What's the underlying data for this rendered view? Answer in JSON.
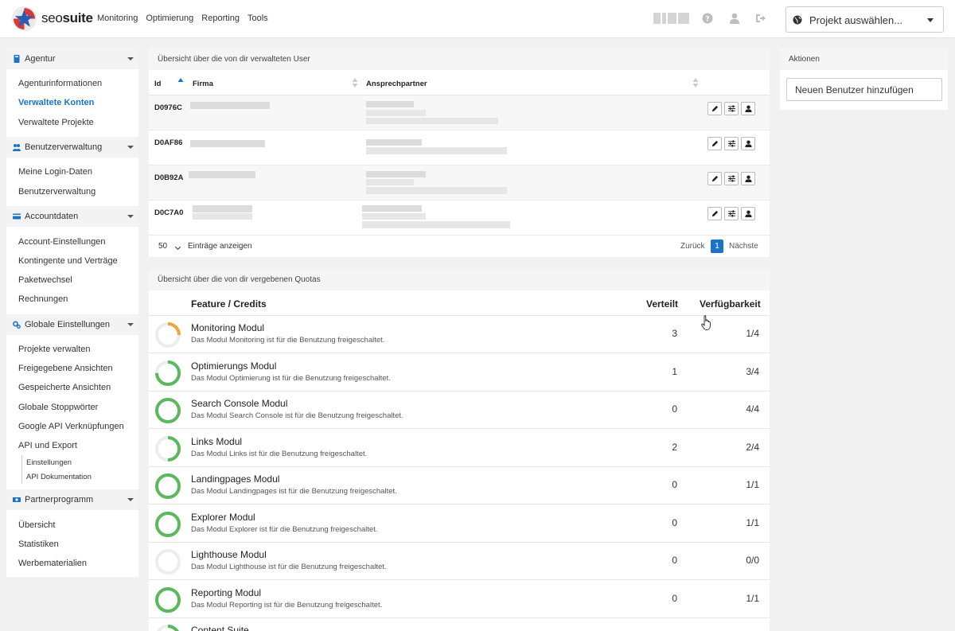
{
  "app": {
    "logo_text_a": "seo",
    "logo_text_b": "suite",
    "nav": [
      "Monitoring",
      "Optimierung",
      "Reporting",
      "Tools"
    ],
    "project_select": "Projekt auswählen..."
  },
  "sidebar": {
    "sections": [
      {
        "title": "Agentur",
        "items": [
          "Agenturinformationen",
          "Verwaltete Konten",
          "Verwaltete Projekte"
        ]
      },
      {
        "title": "Benutzerverwaltung",
        "items": [
          "Meine Login-Daten",
          "Benutzerverwaltung"
        ]
      },
      {
        "title": "Accountdaten",
        "items": [
          "Account-Einstellungen",
          "Kontingente und Verträge",
          "Paketwechsel",
          "Rechnungen"
        ]
      },
      {
        "title": "Globale Einstellungen",
        "items": [
          "Projekte verwalten",
          "Freigegebene Ansichten",
          "Gespeicherte Ansichten",
          "Globale Stoppwörter",
          "Google API Verknüpfungen",
          "API und Export"
        ],
        "subitems": [
          "Einstellungen",
          "API Dokumentation"
        ]
      },
      {
        "title": "Partnerprogramm",
        "items": [
          "Übersicht",
          "Statistiken",
          "Werbematerialien"
        ]
      }
    ],
    "active_item": "Verwaltete Konten"
  },
  "users": {
    "title": "Übersicht über die von dir verwalteten User",
    "columns": [
      "Id",
      "Firma",
      "Ansprechpartner"
    ],
    "rows": [
      "D0976C",
      "D0AF86",
      "D0B92A",
      "D0C7A0"
    ],
    "page_length": "50",
    "page_length_label": "Einträge anzeigen",
    "prev": "Zurück",
    "current_page": "1",
    "next": "Nächste"
  },
  "quotas": {
    "title": "Übersicht über die von dir vergebenen Quotas",
    "columns": [
      "Feature / Credits",
      "Verteilt",
      "Verfügbarkeit"
    ],
    "rows": [
      {
        "name": "Monitoring Modul",
        "desc": "Das Modul Monitoring ist für die Benutzung freigeschaltet.",
        "distributed": "3",
        "availability": "1/4",
        "fraction": 0.25,
        "color": "#f0a23c"
      },
      {
        "name": "Optimierungs Modul",
        "desc": "Das Modul Optimierung ist für die Benutzung freigeschaltet.",
        "distributed": "1",
        "availability": "3/4",
        "fraction": 0.75,
        "color": "#5cb85c"
      },
      {
        "name": "Search Console Modul",
        "desc": "Das Modul Search Console ist für die Benutzung freigeschaltet.",
        "distributed": "0",
        "availability": "4/4",
        "fraction": 1.0,
        "color": "#5cb85c"
      },
      {
        "name": "Links Modul",
        "desc": "Das Modul Links ist für die Benutzung freigeschaltet.",
        "distributed": "2",
        "availability": "2/4",
        "fraction": 0.5,
        "color": "#5cb85c"
      },
      {
        "name": "Landingpages Modul",
        "desc": "Das Modul Landingpages ist für die Benutzung freigeschaltet.",
        "distributed": "0",
        "availability": "1/1",
        "fraction": 1.0,
        "color": "#5cb85c"
      },
      {
        "name": "Explorer Modul",
        "desc": "Das Modul Explorer ist für die Benutzung freigeschaltet.",
        "distributed": "0",
        "availability": "1/1",
        "fraction": 1.0,
        "color": "#5cb85c"
      },
      {
        "name": "Lighthouse Modul",
        "desc": "Das Modul Lighthouse ist für die Benutzung freigeschaltet.",
        "distributed": "0",
        "availability": "0/0",
        "fraction": 0.0,
        "color": "#5cb85c"
      },
      {
        "name": "Reporting Modul",
        "desc": "Das Modul Reporting ist für die Benutzung freigeschaltet.",
        "distributed": "0",
        "availability": "1/1",
        "fraction": 1.0,
        "color": "#5cb85c"
      },
      {
        "name": "Content Suite",
        "desc": "",
        "distributed": "",
        "availability": "",
        "fraction": 0.25,
        "color": "#5cb85c"
      }
    ]
  },
  "actions": {
    "title": "Aktionen",
    "add_user": "Neuen Benutzer hinzufügen"
  },
  "icons": [
    "seosuite-logo-icon",
    "help-icon",
    "user-icon",
    "logout-icon",
    "globe-icon",
    "book-icon",
    "users-icon",
    "card-icon",
    "cogs-icon",
    "money-icon",
    "sort-icon",
    "pencil-icon",
    "sliders-icon",
    "user-icon"
  ]
}
